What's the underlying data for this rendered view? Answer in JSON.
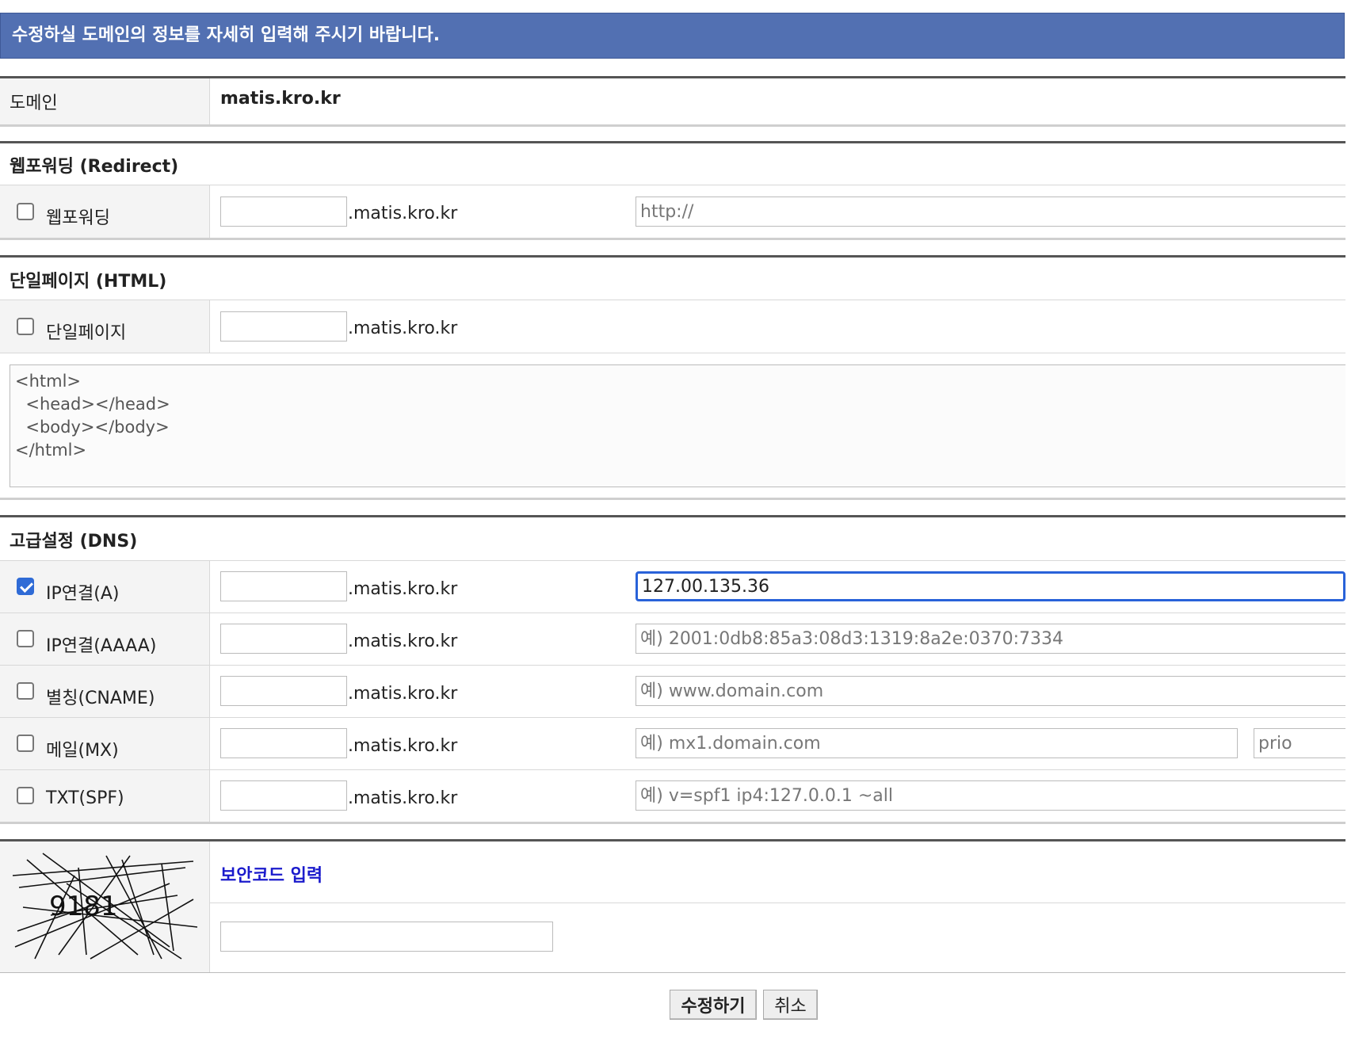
{
  "banner": "수정하실 도메인의 정보를 자세히 입력해 주시기 바랍니다.",
  "domain": {
    "label": "도메인",
    "value": "matis.kro.kr"
  },
  "suffix": ".matis.kro.kr",
  "redirect": {
    "section": "웹포워딩 (Redirect)",
    "label": "웹포워딩",
    "checked": false,
    "url_placeholder": "http://"
  },
  "html_page": {
    "section": "단일페이지 (HTML)",
    "label": "단일페이지",
    "checked": false,
    "content": "<html>\n  <head></head>\n  <body></body>\n</html>"
  },
  "dns": {
    "section": "고급설정 (DNS)",
    "rows": [
      {
        "label": "IP연결(A)",
        "checked": true,
        "value": "127.00.135.36",
        "placeholder": ""
      },
      {
        "label": "IP연결(AAAA)",
        "checked": false,
        "value": "",
        "placeholder": "예) 2001:0db8:85a3:08d3:1319:8a2e:0370:7334"
      },
      {
        "label": "별칭(CNAME)",
        "checked": false,
        "value": "",
        "placeholder": "예) www.domain.com"
      },
      {
        "label": "메일(MX)",
        "checked": false,
        "value": "",
        "placeholder": "예) mx1.domain.com",
        "prio_placeholder": "prio"
      },
      {
        "label": "TXT(SPF)",
        "checked": false,
        "value": "",
        "placeholder": "예) v=spf1 ip4:127.0.0.1 ~all"
      }
    ]
  },
  "captcha": {
    "code_image_text": "9181",
    "label": "보안코드 입력"
  },
  "buttons": {
    "submit": "수정하기",
    "cancel": "취소"
  },
  "colors": {
    "banner": "#5270b2",
    "accent_link": "#1a1acc",
    "focus": "#2962d9"
  }
}
